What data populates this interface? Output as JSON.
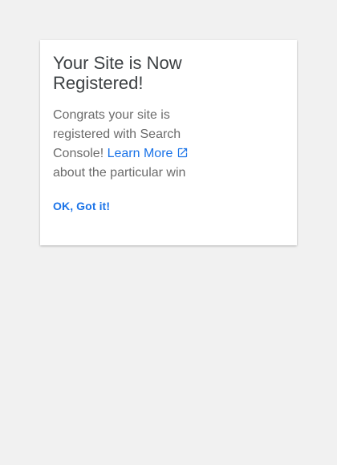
{
  "dialog": {
    "title": "Your Site is Now Registered!",
    "body_prefix": "Congrats your site is registered with Search Console!",
    "learn_more_label": "Learn More",
    "body_suffix": "about the particular win",
    "confirm_label": "OK, Got it!",
    "external_link_icon": "open-in-new-icon"
  },
  "colors": {
    "background": "#f1f1f1",
    "card": "#ffffff",
    "title": "#3c4043",
    "body_text": "#6b6b6b",
    "link": "#1a73e8"
  }
}
